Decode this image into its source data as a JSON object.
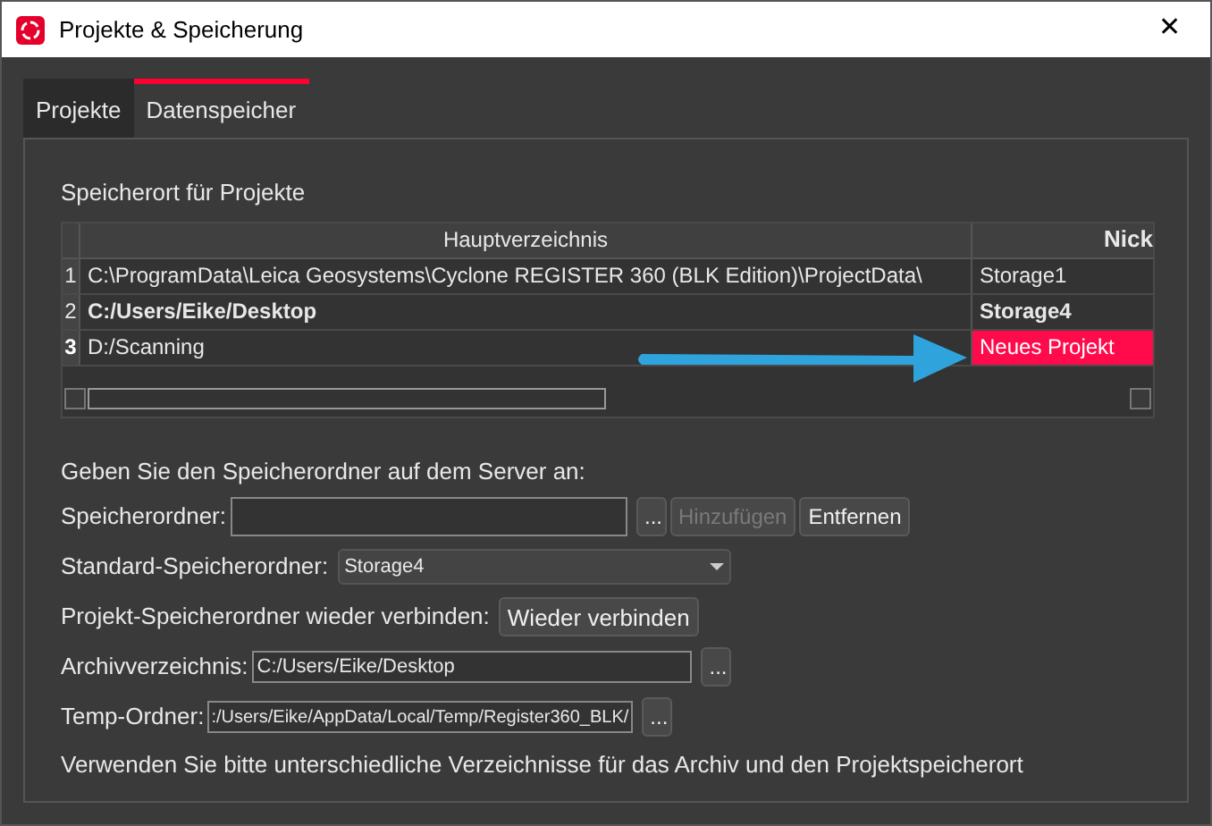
{
  "window": {
    "title": "Projekte & Speicherung",
    "close": "✕"
  },
  "tabs": [
    {
      "label": "Projekte",
      "selected": false
    },
    {
      "label": "Datenspeicher",
      "selected": true
    }
  ],
  "section_title": "Speicherort für Projekte",
  "table": {
    "columns": [
      "Hauptverzeichnis",
      "Nick"
    ],
    "rows": [
      {
        "number": "1",
        "path": "C:\\ProgramData\\Leica Geosystems\\Cyclone REGISTER 360 (BLK Edition)\\ProjectData\\",
        "nickname": "Storage1",
        "default": false,
        "selected": false
      },
      {
        "number": "2",
        "path": "C:/Users/Eike/Desktop",
        "nickname": "Storage4",
        "default": true,
        "selected": false
      },
      {
        "number": "3",
        "path": "D:/Scanning",
        "nickname": "Neues Projekt",
        "default": false,
        "selected": true
      }
    ]
  },
  "server_hint": "Geben Sie den Speicherordner auf dem Server an:",
  "storage_folder": {
    "label": "Speicherordner:",
    "browse": "...",
    "add": {
      "label": "Hinzufügen",
      "disabled": true
    },
    "remove": {
      "label": "Entfernen",
      "disabled": false
    }
  },
  "default_folder": {
    "label": "Standard-Speicherordner:",
    "value": "Storage4"
  },
  "reconnect": {
    "label": "Projekt-Speicherordner wieder verbinden:",
    "button": "Wieder verbinden"
  },
  "archive": {
    "label": "Archivverzeichnis:",
    "value": "C:/Users/Eike/Desktop",
    "browse": "..."
  },
  "temp": {
    "label": "Temp-Ordner:",
    "value": ":/Users/Eike/AppData/Local/Temp/Register360_BLK/",
    "browse": "..."
  },
  "note": "Verwenden Sie bitte unterschiedliche Verzeichnisse für das Archiv und den Projektspeicherort"
}
